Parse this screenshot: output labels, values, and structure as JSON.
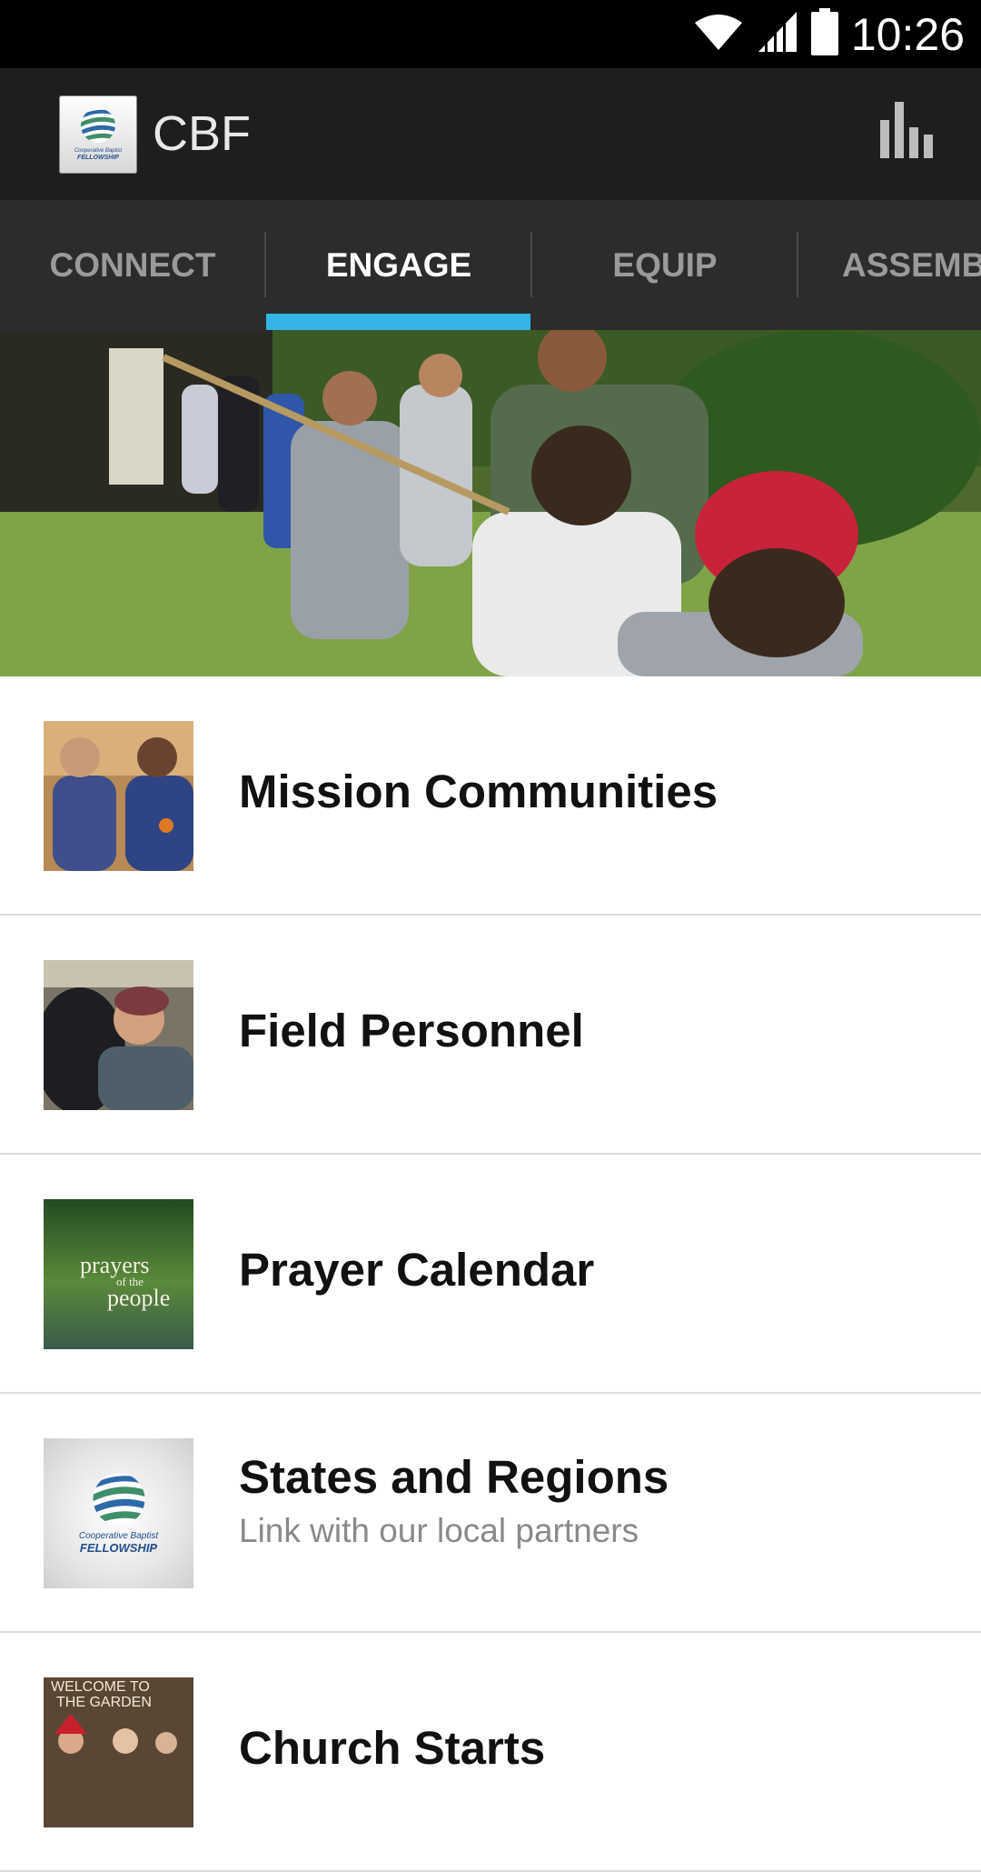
{
  "status_bar": {
    "time": "10:26",
    "icons": [
      "wifi-icon",
      "signal-icon",
      "battery-icon"
    ]
  },
  "app_bar": {
    "title": "CBF",
    "logo_text_line1": "Cooperative Baptist",
    "logo_text_line2": "FELLOWSHIP",
    "action_icon": "bar-chart-icon"
  },
  "tabs": [
    {
      "label": "CONNECT",
      "active": false
    },
    {
      "label": "ENGAGE",
      "active": true
    },
    {
      "label": "EQUIP",
      "active": false
    },
    {
      "label": "ASSEMB",
      "active": false
    }
  ],
  "hero_image": {
    "icon": "volunteers-tug-of-war-photo"
  },
  "list_items": [
    {
      "title": "Mission Communities",
      "subtitle": "",
      "thumb": "mission-communities-photo"
    },
    {
      "title": "Field Personnel",
      "subtitle": "",
      "thumb": "field-personnel-photo"
    },
    {
      "title": "Prayer Calendar",
      "subtitle": "",
      "thumb": "prayer-calendar-photo",
      "thumb_text": [
        "prayers",
        "of the",
        "people"
      ]
    },
    {
      "title": "States and Regions",
      "subtitle": "Link with our local partners",
      "thumb": "cbf-logo-thumb",
      "thumb_text": [
        "Cooperative Baptist",
        "FELLOWSHIP"
      ]
    },
    {
      "title": "Church Starts",
      "subtitle": "",
      "thumb": "church-starts-photo",
      "thumb_text": [
        "WELCOME TO",
        "THE GARDEN"
      ]
    }
  ],
  "colors": {
    "status_bar": "#000000",
    "app_bar": "#1e1e1e",
    "tab_bar": "#2c2c2c",
    "tab_indicator": "#33b5e5",
    "tab_inactive_text": "#9a9a9a",
    "tab_active_text": "#ffffff"
  }
}
